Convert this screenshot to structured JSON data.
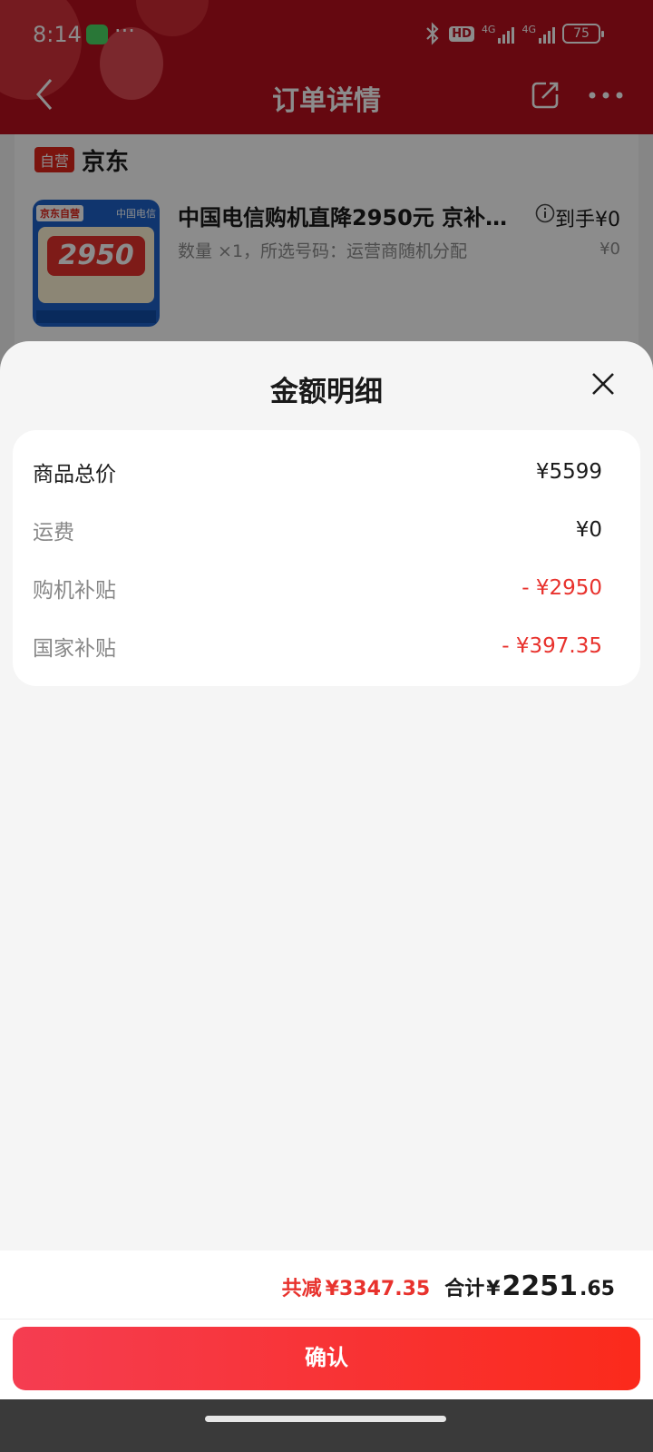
{
  "status_bar": {
    "time": "8:14",
    "dots": "···",
    "hd": "HD",
    "network_1": "4G",
    "network_2": "4G",
    "battery": "75"
  },
  "nav": {
    "title": "订单详情"
  },
  "order": {
    "self_tag": "自营",
    "shop_name": "京东",
    "thumb": {
      "jd_label": "京东自营",
      "telecom_label": "中国电信",
      "price": "2950"
    },
    "product_title": "中国电信购机直降2950元 京补…",
    "arrival_price": "到手¥0",
    "spec": "数量 ×1，所选号码：运营商随机分配",
    "unit_price": "¥0"
  },
  "sheet": {
    "title": "金额明细",
    "rows": [
      {
        "label": "商品总价",
        "value": "¥5599"
      },
      {
        "label": "运费",
        "value": "¥0"
      },
      {
        "label": "购机补贴",
        "value": "- ¥2950"
      },
      {
        "label": "国家补贴",
        "value": "- ¥397.35"
      }
    ],
    "summary": {
      "reduce_label": "共减",
      "reduce_value": "¥3347.35",
      "total_label": "合计",
      "total_currency": "¥",
      "total_integer": "2251",
      "total_decimal": ".65"
    },
    "confirm_label": "确认"
  },
  "colors": {
    "header_red": "#b80f1e",
    "accent_red": "#e8322d",
    "button_gradient_start": "#f53d51",
    "button_gradient_end": "#fb2a1b"
  },
  "icons": {
    "back": "chevron-left-icon",
    "share": "share-icon",
    "more": "more-icon",
    "close": "close-icon",
    "info": "info-icon",
    "bluetooth": "bluetooth-icon"
  }
}
